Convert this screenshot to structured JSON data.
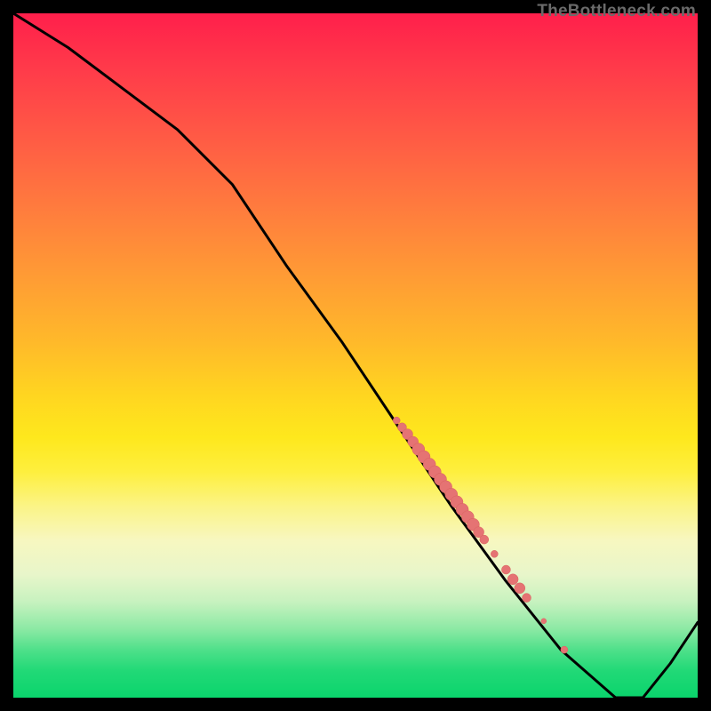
{
  "watermark": "TheBottleneck.com",
  "colors": {
    "line": "#000000",
    "marker_fill": "#e57373",
    "marker_stroke": "#d9635f"
  },
  "chart_data": {
    "type": "line",
    "title": "",
    "xlabel": "",
    "ylabel": "",
    "xlim": [
      0,
      100
    ],
    "ylim": [
      0,
      100
    ],
    "series": [
      {
        "name": "curve",
        "x": [
          0,
          8,
          16,
          24,
          32,
          40,
          48,
          56,
          64,
          72,
          80,
          88,
          92,
          96,
          100
        ],
        "values": [
          100,
          95,
          89,
          83,
          75,
          63,
          52,
          40,
          28,
          17,
          7,
          0,
          0,
          5,
          11
        ]
      }
    ],
    "markers": [
      {
        "x": 56.0,
        "y": 40.5,
        "r": 4
      },
      {
        "x": 56.8,
        "y": 39.5,
        "r": 5
      },
      {
        "x": 57.6,
        "y": 38.5,
        "r": 6
      },
      {
        "x": 58.4,
        "y": 37.4,
        "r": 6
      },
      {
        "x": 59.2,
        "y": 36.3,
        "r": 7
      },
      {
        "x": 60.0,
        "y": 35.2,
        "r": 7
      },
      {
        "x": 60.8,
        "y": 34.1,
        "r": 7
      },
      {
        "x": 61.6,
        "y": 33.0,
        "r": 7
      },
      {
        "x": 62.4,
        "y": 31.9,
        "r": 7
      },
      {
        "x": 63.2,
        "y": 30.8,
        "r": 7
      },
      {
        "x": 64.0,
        "y": 29.7,
        "r": 7
      },
      {
        "x": 64.8,
        "y": 28.6,
        "r": 7
      },
      {
        "x": 65.6,
        "y": 27.5,
        "r": 7
      },
      {
        "x": 66.4,
        "y": 26.4,
        "r": 7
      },
      {
        "x": 67.2,
        "y": 25.3,
        "r": 7
      },
      {
        "x": 68.0,
        "y": 24.2,
        "r": 6
      },
      {
        "x": 68.8,
        "y": 23.1,
        "r": 5
      },
      {
        "x": 70.3,
        "y": 21.0,
        "r": 4
      },
      {
        "x": 72.0,
        "y": 18.7,
        "r": 5
      },
      {
        "x": 73.0,
        "y": 17.3,
        "r": 6
      },
      {
        "x": 74.0,
        "y": 16.0,
        "r": 6
      },
      {
        "x": 75.0,
        "y": 14.6,
        "r": 5
      },
      {
        "x": 77.5,
        "y": 11.2,
        "r": 3
      },
      {
        "x": 80.5,
        "y": 7.0,
        "r": 4
      }
    ]
  }
}
